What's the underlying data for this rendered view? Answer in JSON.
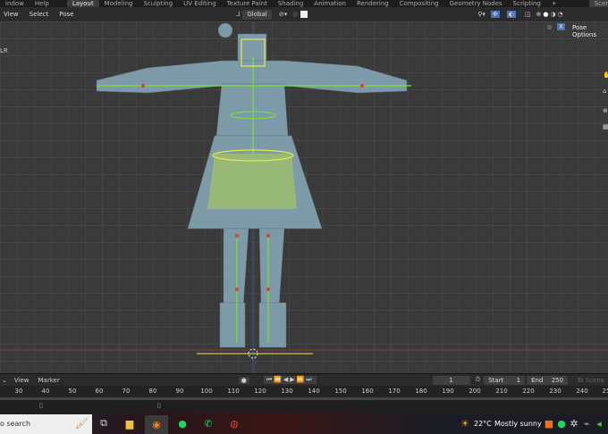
{
  "topbar": {
    "menus": [
      "indow",
      "Help"
    ],
    "tabs": [
      "Layout",
      "Modeling",
      "Sculpting",
      "UV Editing",
      "Texture Paint",
      "Shading",
      "Animation",
      "Rendering",
      "Compositing",
      "Geometry Nodes",
      "Scripting",
      "+"
    ],
    "scene": "Scene"
  },
  "header": {
    "menus": [
      "View",
      "Select",
      "Pose"
    ],
    "orientation": "Global",
    "pose_options": "Pose Options",
    "x_label": "X",
    "left_label": "LR"
  },
  "timeline": {
    "menus": [
      "View",
      "Marker"
    ],
    "current_frame": "1",
    "start_label": "Start",
    "start": "1",
    "end_label": "End",
    "end": "250",
    "to_scene": "To Scene",
    "ticks": [
      "30",
      "40",
      "50",
      "60",
      "70",
      "80",
      "90",
      "100",
      "110",
      "120",
      "130",
      "140",
      "150",
      "160",
      "170",
      "180",
      "190",
      "200",
      "210",
      "220",
      "230",
      "240",
      "25"
    ]
  },
  "taskbar": {
    "search": "o search",
    "weather_temp": "22°C",
    "weather_text": "Mostly sunny"
  },
  "colors": {
    "accent": "#4772b3",
    "bone_green": "#7ddf3a",
    "mesh": "#7d9aa8"
  }
}
